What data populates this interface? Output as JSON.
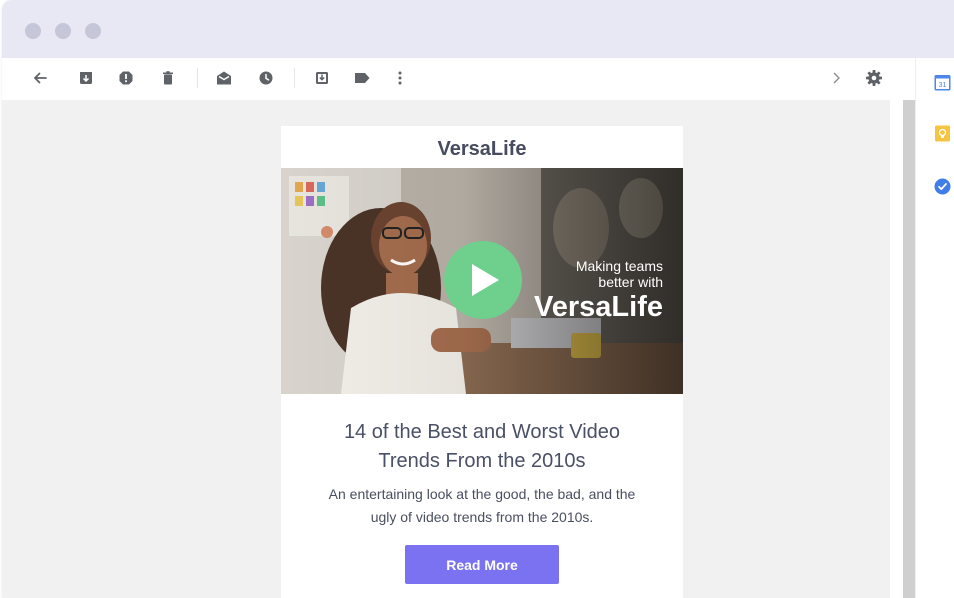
{
  "email": {
    "brand": "VersaLife",
    "hero": {
      "tagline_line1": "Making teams",
      "tagline_line2": "better with",
      "tagline_brand": "VersaLife"
    },
    "headline_line1": "14 of the Best and Worst Video",
    "headline_line2": "Trends From the 2010s",
    "description_line1": "An entertaining look at the good, the bad, and the",
    "description_line2": "ugly of video trends from the 2010s.",
    "cta_label": "Read More"
  },
  "side_panel": {
    "calendar_badge": "31"
  },
  "colors": {
    "accent": "#7a72f0",
    "play_button": "#6fcf8d",
    "titlebar": "#e7e8f4",
    "window_dot": "#c5c7d9"
  }
}
